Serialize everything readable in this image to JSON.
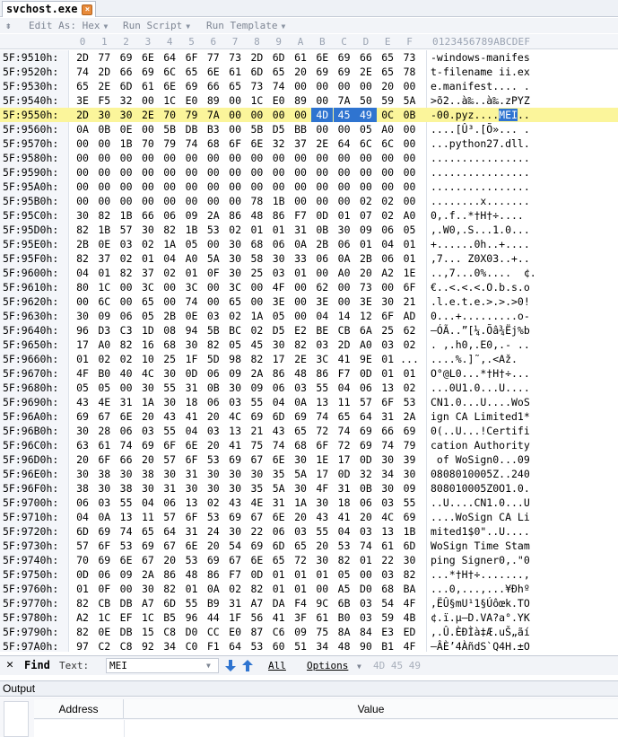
{
  "tab": {
    "title": "svchost.exe"
  },
  "toolbar": {
    "edit_as": "Edit As: Hex",
    "run_script": "Run Script",
    "run_template": "Run Template"
  },
  "header": {
    "columns": [
      "0",
      "1",
      "2",
      "3",
      "4",
      "5",
      "6",
      "7",
      "8",
      "9",
      "A",
      "B",
      "C",
      "D",
      "E",
      "F"
    ],
    "ascii": "0123456789ABCDEF"
  },
  "rows": [
    {
      "offset": "5F:9510h:",
      "bytes": [
        "2D",
        "77",
        "69",
        "6E",
        "64",
        "6F",
        "77",
        "73",
        "2D",
        "6D",
        "61",
        "6E",
        "69",
        "66",
        "65",
        "73"
      ],
      "ascii": "-windows-manifes"
    },
    {
      "offset": "5F:9520h:",
      "bytes": [
        "74",
        "2D",
        "66",
        "69",
        "6C",
        "65",
        "6E",
        "61",
        "6D",
        "65",
        "20",
        "69",
        "69",
        "2E",
        "65",
        "78"
      ],
      "ascii": "t-filename ii.ex"
    },
    {
      "offset": "5F:9530h:",
      "bytes": [
        "65",
        "2E",
        "6D",
        "61",
        "6E",
        "69",
        "66",
        "65",
        "73",
        "74",
        "00",
        "00",
        "00",
        "00",
        "20",
        "00"
      ],
      "ascii": "e.manifest.... ."
    },
    {
      "offset": "5F:9540h:",
      "bytes": [
        "3E",
        "F5",
        "32",
        "00",
        "1C",
        "E0",
        "89",
        "00",
        "1C",
        "E0",
        "89",
        "00",
        "7A",
        "50",
        "59",
        "5A"
      ],
      "ascii": ">õ2..à‰..à‰.zPYZ"
    },
    {
      "offset": "5F:9550h:",
      "bytes": [
        "2D",
        "30",
        "30",
        "2E",
        "70",
        "79",
        "7A",
        "00",
        "00",
        "00",
        "00",
        "4D",
        "45",
        "49",
        "0C",
        "0B"
      ],
      "ascii": "-00.pyz....MEI..",
      "highlight": true,
      "sel_bytes": [
        11,
        12,
        13
      ],
      "ascii_pre": "-00.pyz....",
      "ascii_sel": "MEI",
      "ascii_post": ".."
    },
    {
      "offset": "5F:9560h:",
      "bytes": [
        "0A",
        "0B",
        "0E",
        "00",
        "5B",
        "DB",
        "B3",
        "00",
        "5B",
        "D5",
        "BB",
        "00",
        "00",
        "05",
        "A0",
        "00"
      ],
      "ascii": "....[Û³.[Õ»... ."
    },
    {
      "offset": "5F:9570h:",
      "bytes": [
        "00",
        "00",
        "1B",
        "70",
        "79",
        "74",
        "68",
        "6F",
        "6E",
        "32",
        "37",
        "2E",
        "64",
        "6C",
        "6C",
        "00"
      ],
      "ascii": "...python27.dll."
    },
    {
      "offset": "5F:9580h:",
      "bytes": [
        "00",
        "00",
        "00",
        "00",
        "00",
        "00",
        "00",
        "00",
        "00",
        "00",
        "00",
        "00",
        "00",
        "00",
        "00",
        "00"
      ],
      "ascii": "................"
    },
    {
      "offset": "5F:9590h:",
      "bytes": [
        "00",
        "00",
        "00",
        "00",
        "00",
        "00",
        "00",
        "00",
        "00",
        "00",
        "00",
        "00",
        "00",
        "00",
        "00",
        "00"
      ],
      "ascii": "................"
    },
    {
      "offset": "5F:95A0h:",
      "bytes": [
        "00",
        "00",
        "00",
        "00",
        "00",
        "00",
        "00",
        "00",
        "00",
        "00",
        "00",
        "00",
        "00",
        "00",
        "00",
        "00"
      ],
      "ascii": "................"
    },
    {
      "offset": "5F:95B0h:",
      "bytes": [
        "00",
        "00",
        "00",
        "00",
        "00",
        "00",
        "00",
        "00",
        "78",
        "1B",
        "00",
        "00",
        "00",
        "02",
        "02",
        "00"
      ],
      "ascii": "........x......."
    },
    {
      "offset": "5F:95C0h:",
      "bytes": [
        "30",
        "82",
        "1B",
        "66",
        "06",
        "09",
        "2A",
        "86",
        "48",
        "86",
        "F7",
        "0D",
        "01",
        "07",
        "02",
        "A0"
      ],
      "ascii": "0‚.f..*†H†÷.... "
    },
    {
      "offset": "5F:95D0h:",
      "bytes": [
        "82",
        "1B",
        "57",
        "30",
        "82",
        "1B",
        "53",
        "02",
        "01",
        "01",
        "31",
        "0B",
        "30",
        "09",
        "06",
        "05"
      ],
      "ascii": ",.W0‚.S...1.0..."
    },
    {
      "offset": "5F:95E0h:",
      "bytes": [
        "2B",
        "0E",
        "03",
        "02",
        "1A",
        "05",
        "00",
        "30",
        "68",
        "06",
        "0A",
        "2B",
        "06",
        "01",
        "04",
        "01"
      ],
      "ascii": "+......0h..+...."
    },
    {
      "offset": "5F:95F0h:",
      "bytes": [
        "82",
        "37",
        "02",
        "01",
        "04",
        "A0",
        "5A",
        "30",
        "58",
        "30",
        "33",
        "06",
        "0A",
        "2B",
        "06",
        "01"
      ],
      "ascii": ",7... Z0X03..+.."
    },
    {
      "offset": "5F:9600h:",
      "bytes": [
        "04",
        "01",
        "82",
        "37",
        "02",
        "01",
        "0F",
        "30",
        "25",
        "03",
        "01",
        "00",
        "A0",
        "20",
        "A2",
        "1E"
      ],
      "ascii": "..,7...0%....  ¢."
    },
    {
      "offset": "5F:9610h:",
      "bytes": [
        "80",
        "1C",
        "00",
        "3C",
        "00",
        "3C",
        "00",
        "3C",
        "00",
        "4F",
        "00",
        "62",
        "00",
        "73",
        "00",
        "6F"
      ],
      "ascii": "€..<.<.<.O.b.s.o"
    },
    {
      "offset": "5F:9620h:",
      "bytes": [
        "00",
        "6C",
        "00",
        "65",
        "00",
        "74",
        "00",
        "65",
        "00",
        "3E",
        "00",
        "3E",
        "00",
        "3E",
        "30",
        "21"
      ],
      "ascii": ".l.e.t.e.>.>.>0!"
    },
    {
      "offset": "5F:9630h:",
      "bytes": [
        "30",
        "09",
        "06",
        "05",
        "2B",
        "0E",
        "03",
        "02",
        "1A",
        "05",
        "00",
        "04",
        "14",
        "12",
        "6F",
        "AD"
      ],
      "ascii": "0...+.........o-"
    },
    {
      "offset": "5F:9640h:",
      "bytes": [
        "96",
        "D3",
        "C3",
        "1D",
        "08",
        "94",
        "5B",
        "BC",
        "02",
        "D5",
        "E2",
        "BE",
        "CB",
        "6A",
        "25",
        "62"
      ],
      "ascii": "–ÓÃ..”[¼.Õâ¾Ëj%b"
    },
    {
      "offset": "5F:9650h:",
      "bytes": [
        "17",
        "A0",
        "82",
        "16",
        "68",
        "30",
        "82",
        "05",
        "45",
        "30",
        "82",
        "03",
        "2D",
        "A0",
        "03",
        "02"
      ],
      "ascii": ". ,.h0,.E0,.- .."
    },
    {
      "offset": "5F:9660h:",
      "bytes": [
        "01",
        "02",
        "02",
        "10",
        "25",
        "1F",
        "5D",
        "98",
        "82",
        "17",
        "2E",
        "3C",
        "41",
        "9E",
        "01",
        "..."
      ],
      "ascii": "....%.]˜,.<Až."
    },
    {
      "offset": "5F:9670h:",
      "bytes": [
        "4F",
        "B0",
        "40",
        "4C",
        "30",
        "0D",
        "06",
        "09",
        "2A",
        "86",
        "48",
        "86",
        "F7",
        "0D",
        "01",
        "01"
      ],
      "ascii": "O°@L0...*†H†÷..."
    },
    {
      "offset": "5F:9680h:",
      "bytes": [
        "05",
        "05",
        "00",
        "30",
        "55",
        "31",
        "0B",
        "30",
        "09",
        "06",
        "03",
        "55",
        "04",
        "06",
        "13",
        "02"
      ],
      "ascii": "...0U1.0...U...."
    },
    {
      "offset": "5F:9690h:",
      "bytes": [
        "43",
        "4E",
        "31",
        "1A",
        "30",
        "18",
        "06",
        "03",
        "55",
        "04",
        "0A",
        "13",
        "11",
        "57",
        "6F",
        "53"
      ],
      "ascii": "CN1.0...U....WoS"
    },
    {
      "offset": "5F:96A0h:",
      "bytes": [
        "69",
        "67",
        "6E",
        "20",
        "43",
        "41",
        "20",
        "4C",
        "69",
        "6D",
        "69",
        "74",
        "65",
        "64",
        "31",
        "2A"
      ],
      "ascii": "ign CA Limited1*"
    },
    {
      "offset": "5F:96B0h:",
      "bytes": [
        "30",
        "28",
        "06",
        "03",
        "55",
        "04",
        "03",
        "13",
        "21",
        "43",
        "65",
        "72",
        "74",
        "69",
        "66",
        "69"
      ],
      "ascii": "0(..U...!Certifi"
    },
    {
      "offset": "5F:96C0h:",
      "bytes": [
        "63",
        "61",
        "74",
        "69",
        "6F",
        "6E",
        "20",
        "41",
        "75",
        "74",
        "68",
        "6F",
        "72",
        "69",
        "74",
        "79"
      ],
      "ascii": "cation Authority"
    },
    {
      "offset": "5F:96D0h:",
      "bytes": [
        "20",
        "6F",
        "66",
        "20",
        "57",
        "6F",
        "53",
        "69",
        "67",
        "6E",
        "30",
        "1E",
        "17",
        "0D",
        "30",
        "39"
      ],
      "ascii": " of WoSign0...09"
    },
    {
      "offset": "5F:96E0h:",
      "bytes": [
        "30",
        "38",
        "30",
        "38",
        "30",
        "31",
        "30",
        "30",
        "30",
        "35",
        "5A",
        "17",
        "0D",
        "32",
        "34",
        "30"
      ],
      "ascii": "0808010005Z..240"
    },
    {
      "offset": "5F:96F0h:",
      "bytes": [
        "38",
        "30",
        "38",
        "30",
        "31",
        "30",
        "30",
        "30",
        "35",
        "5A",
        "30",
        "4F",
        "31",
        "0B",
        "30",
        "09"
      ],
      "ascii": "808010005Z0O1.0."
    },
    {
      "offset": "5F:9700h:",
      "bytes": [
        "06",
        "03",
        "55",
        "04",
        "06",
        "13",
        "02",
        "43",
        "4E",
        "31",
        "1A",
        "30",
        "18",
        "06",
        "03",
        "55"
      ],
      "ascii": "..U....CN1.0...U"
    },
    {
      "offset": "5F:9710h:",
      "bytes": [
        "04",
        "0A",
        "13",
        "11",
        "57",
        "6F",
        "53",
        "69",
        "67",
        "6E",
        "20",
        "43",
        "41",
        "20",
        "4C",
        "69"
      ],
      "ascii": "....WoSign CA Li"
    },
    {
      "offset": "5F:9720h:",
      "bytes": [
        "6D",
        "69",
        "74",
        "65",
        "64",
        "31",
        "24",
        "30",
        "22",
        "06",
        "03",
        "55",
        "04",
        "03",
        "13",
        "1B"
      ],
      "ascii": "mited1$0\"..U...."
    },
    {
      "offset": "5F:9730h:",
      "bytes": [
        "57",
        "6F",
        "53",
        "69",
        "67",
        "6E",
        "20",
        "54",
        "69",
        "6D",
        "65",
        "20",
        "53",
        "74",
        "61",
        "6D"
      ],
      "ascii": "WoSign Time Stam"
    },
    {
      "offset": "5F:9740h:",
      "bytes": [
        "70",
        "69",
        "6E",
        "67",
        "20",
        "53",
        "69",
        "67",
        "6E",
        "65",
        "72",
        "30",
        "82",
        "01",
        "22",
        "30"
      ],
      "ascii": "ping Signer0,.\"0"
    },
    {
      "offset": "5F:9750h:",
      "bytes": [
        "0D",
        "06",
        "09",
        "2A",
        "86",
        "48",
        "86",
        "F7",
        "0D",
        "01",
        "01",
        "01",
        "05",
        "00",
        "03",
        "82"
      ],
      "ascii": "...*†H†÷.......,"
    },
    {
      "offset": "5F:9760h:",
      "bytes": [
        "01",
        "0F",
        "00",
        "30",
        "82",
        "01",
        "0A",
        "02",
        "82",
        "01",
        "01",
        "00",
        "A5",
        "D0",
        "68",
        "BA"
      ],
      "ascii": "...0,...,...¥Ðhº"
    },
    {
      "offset": "5F:9770h:",
      "bytes": [
        "82",
        "CB",
        "DB",
        "A7",
        "6D",
        "55",
        "B9",
        "31",
        "A7",
        "DA",
        "F4",
        "9C",
        "6B",
        "03",
        "54",
        "4F"
      ],
      "ascii": ",ËÛ§mU¹1§Úôœk.TO"
    },
    {
      "offset": "5F:9780h:",
      "bytes": [
        "A2",
        "1C",
        "EF",
        "1C",
        "B5",
        "96",
        "44",
        "1F",
        "56",
        "41",
        "3F",
        "61",
        "B0",
        "03",
        "59",
        "4B"
      ],
      "ascii": "¢.ï.µ–D.VA?a°.YK"
    },
    {
      "offset": "5F:9790h:",
      "bytes": [
        "82",
        "0E",
        "DB",
        "15",
        "C8",
        "D0",
        "CC",
        "E0",
        "87",
        "C6",
        "09",
        "75",
        "8A",
        "84",
        "E3",
        "ED"
      ],
      "ascii": ",.Û.ÈÐÌà‡Æ.uŠ„ãí"
    },
    {
      "offset": "5F:97A0h:",
      "bytes": [
        "97",
        "C2",
        "C8",
        "92",
        "34",
        "C0",
        "F1",
        "64",
        "53",
        "60",
        "51",
        "34",
        "48",
        "90",
        "B1",
        "4F"
      ],
      "ascii": "—ÂÈ’4ÀñdS`Q4H.±O"
    }
  ],
  "find": {
    "title": "Find",
    "type_label": "Text:",
    "query": "MEI",
    "all_label": "All",
    "options_label": "Options",
    "hex_preview": "4D 45 49"
  },
  "output": {
    "title": "Output",
    "columns": {
      "address": "Address",
      "value": "Value"
    }
  }
}
